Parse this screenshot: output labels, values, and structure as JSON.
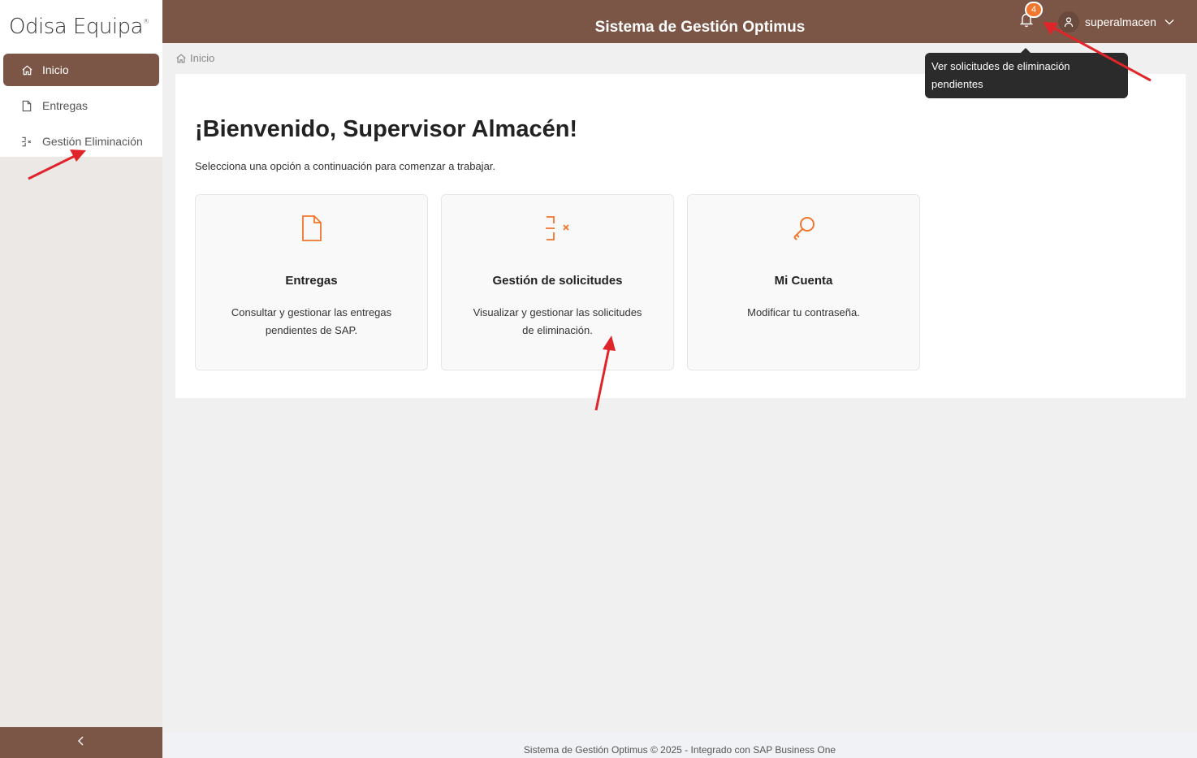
{
  "sidebar": {
    "logo": "Odisa Equipa",
    "logo_mark": "®",
    "items": [
      {
        "label": "Inicio",
        "icon": "home-icon",
        "active": true
      },
      {
        "label": "Entregas",
        "icon": "file-icon",
        "active": false
      },
      {
        "label": "Gestión Eliminación",
        "icon": "delete-request-icon",
        "active": false
      }
    ],
    "collapse_icon": "chevron-left-icon"
  },
  "header": {
    "title": "Sistema de Gestión Optimus",
    "notifications_count": "4",
    "username": "superalmacen",
    "colors": {
      "brand": "#7b5646",
      "accent": "#f0772d"
    }
  },
  "tooltip": {
    "text": "Ver solicitudes de eliminación pendientes"
  },
  "breadcrumb": {
    "label": "Inicio"
  },
  "main": {
    "welcome": "¡Bienvenido, Supervisor Almacén!",
    "subtitle": "Selecciona una opción a continuación para comenzar a trabajar.",
    "cards": [
      {
        "title": "Entregas",
        "desc": "Consultar y gestionar las entregas pendientes de SAP.",
        "icon": "file-icon"
      },
      {
        "title": "Gestión de solicitudes",
        "desc": "Visualizar y gestionar las solicitudes de eliminación.",
        "icon": "delete-request-icon"
      },
      {
        "title": "Mi Cuenta",
        "desc": "Modificar tu contraseña.",
        "icon": "key-icon"
      }
    ]
  },
  "footer": {
    "text": "Sistema de Gestión Optimus © 2025 - Integrado con SAP Business One"
  }
}
